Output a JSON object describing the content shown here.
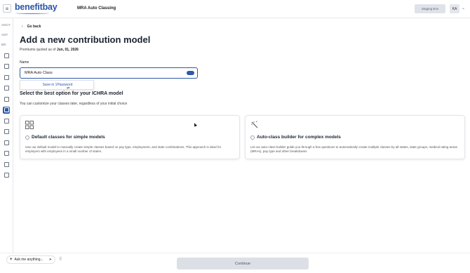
{
  "header": {
    "logo_text": "benefitbay",
    "page_title": "MRA Auto Classing",
    "env_badge": "Staging Env",
    "user_initials": "KA"
  },
  "sidebar": {
    "tags": [
      "AGCY",
      "AGT",
      "ER"
    ],
    "icons": [
      "bank-icon",
      "image-icon",
      "user-add-icon",
      "card-icon",
      "document-icon",
      "contribution-icon",
      "file-icon",
      "building-icon",
      "mail-icon",
      "calculator-icon",
      "money-icon",
      "briefcase-icon"
    ],
    "active_index": 5
  },
  "main": {
    "back_label": "Go back",
    "title": "Add a new contribution model",
    "premiums_prefix": "Premiums quoted as of",
    "premiums_date": "Jun, 01, 2026",
    "name_label": "Name",
    "name_value": "MRA Auto Class",
    "password_popup_label": "Save in 1Password",
    "select_title": "Select the best option for your ICHRA model",
    "select_subtitle": "You can customize your classes later, regardless of your initial choice"
  },
  "options": [
    {
      "title": "Default classes for simple models",
      "description": "Use our default model to manually create simple classes based on pay type, employment, and state combinations. This approach is ideal for employers with employees in a small number of states.",
      "icon": "grid-icon"
    },
    {
      "title": "Auto-class builder for complex models",
      "description": "Let our auto-class builder guide you through a few questions to automatically create multiple classes by all states, state groups, medical rating areas (MRAs), pay type and other breakdowns",
      "icon": "magic-wand-icon"
    }
  ],
  "footer": {
    "ask_label": "Ask me anything...",
    "continue_label": "Continue"
  },
  "colors": {
    "brand": "#2d5aa8",
    "logo": "#2a54a6",
    "disabled_button": "#dce0e6"
  }
}
